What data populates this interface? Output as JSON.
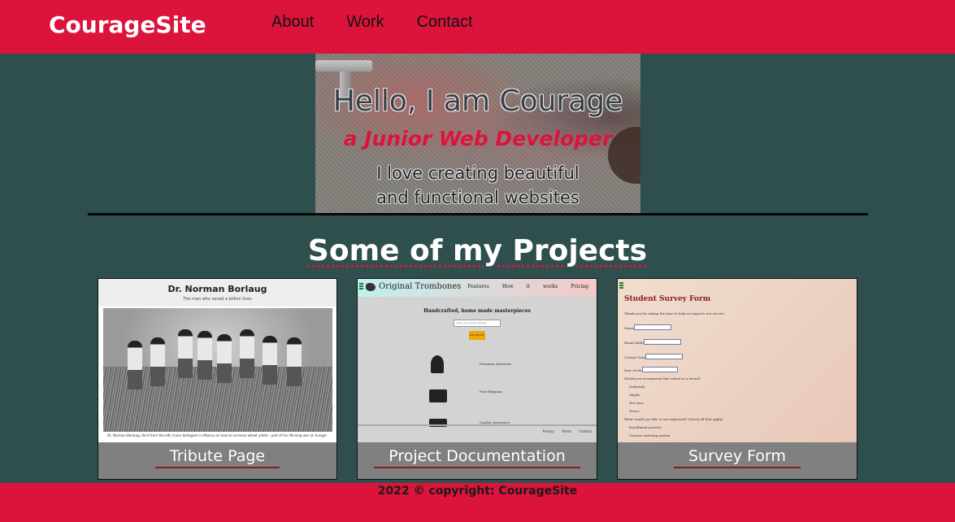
{
  "nav": {
    "brand": "CourageSite",
    "links": [
      "About",
      "Work",
      "Contact"
    ]
  },
  "hero": {
    "title": "Hello, I am Courage",
    "subtitle": "a Junior Web Developer",
    "tagline_line1": "I love creating beautiful",
    "tagline_line2": "and functional websites"
  },
  "projects": {
    "heading": "Some of my Projects",
    "items": [
      {
        "label": "Tribute Page",
        "thumb_title": "Dr. Norman Borlaug",
        "thumb_subtitle": "The man who saved a billion lives",
        "thumb_caption": "Dr. Norman Borlaug, third from the left, trains biologists in Mexico on how to increase wheat yields - part of his life-long war on hunger."
      },
      {
        "label": "Project Documentation",
        "thumb_logo": "Original Trombones",
        "thumb_nav": "Features How it works Pricing",
        "thumb_heading": "Handcrafted, home made masterpieces",
        "thumb_input_placeholder": "enter your email address",
        "thumb_button": "Get Started",
        "thumb_features": [
          "Premium Materials",
          "Fast Shipping",
          "Quality Assurance"
        ],
        "thumb_footer": "Privacy Terms Contact"
      },
      {
        "label": "Survey Form",
        "thumb_title": "Student Survey Form",
        "thumb_intro": "Thank you for taking the time to help us improve our service",
        "thumb_fields": [
          "Name:",
          "Email Address:",
          "Contact Number:",
          "Year of study:"
        ],
        "thumb_question1": "Would you recommend this school to a friend?",
        "thumb_options": [
          "Definitely",
          "Maybe",
          "Not sure",
          "Never"
        ],
        "thumb_question2": "What would you like to see improved? (check all that apply)",
        "thumb_checks": [
          "Enrollment process",
          "Courses ordering system"
        ]
      }
    ]
  },
  "footer": {
    "text": "2022 © copyright: CourageSite"
  },
  "colors": {
    "accent": "#dc143c",
    "background": "#2f4f4f",
    "card_caption": "#808080"
  }
}
